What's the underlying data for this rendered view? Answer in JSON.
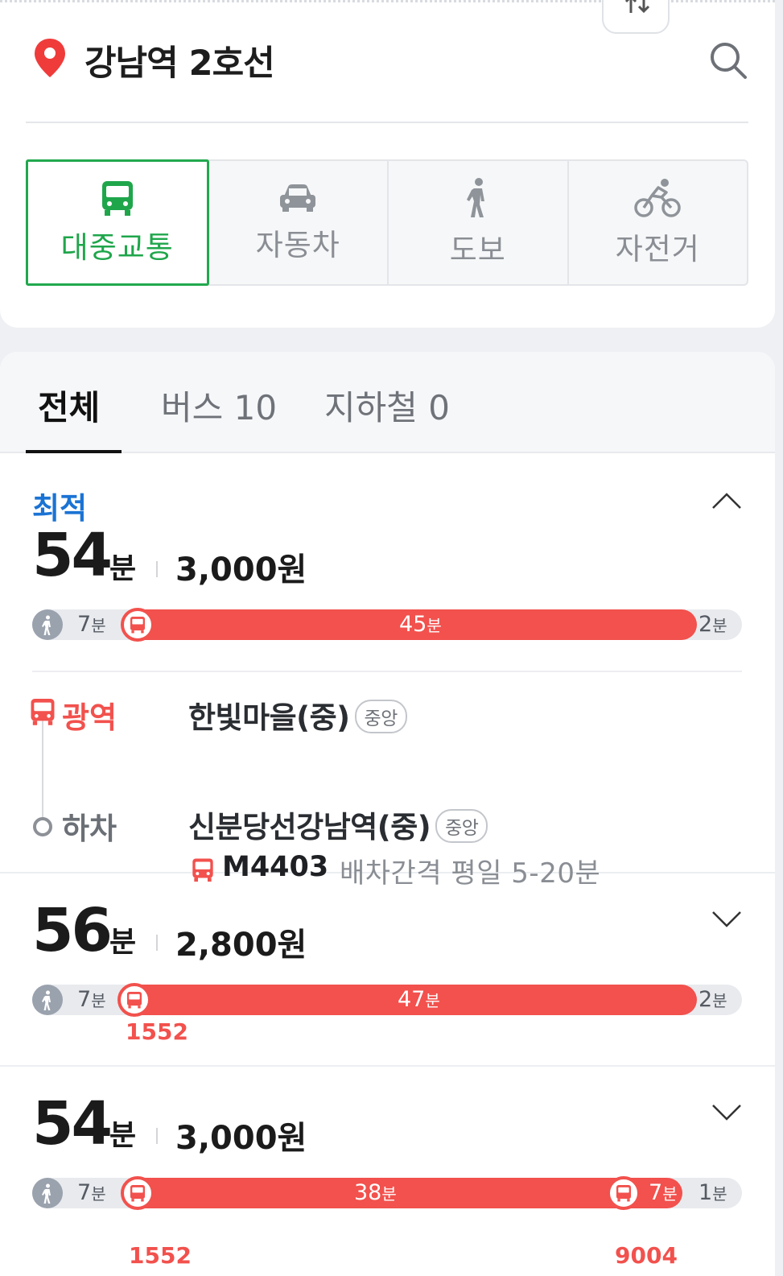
{
  "header": {
    "station_title": "강남역 2호선"
  },
  "modes": [
    {
      "label": "대중교통",
      "icon": "bus-icon",
      "active": true
    },
    {
      "label": "자동차",
      "icon": "car-icon",
      "active": false
    },
    {
      "label": "도보",
      "icon": "walk-icon",
      "active": false
    },
    {
      "label": "자전거",
      "icon": "bicycle-icon",
      "active": false
    }
  ],
  "tabs": [
    {
      "label": "전체",
      "active": true
    },
    {
      "label": "버스 10",
      "active": false
    },
    {
      "label": "지하철 0",
      "active": false
    }
  ],
  "routes": [
    {
      "badge": "최적",
      "duration": "54",
      "duration_unit": "분",
      "fare": "3,000원",
      "segments": [
        {
          "type": "walk",
          "minutes": "7",
          "unit": "분"
        },
        {
          "type": "bus",
          "minutes": "45",
          "unit": "분"
        },
        {
          "type": "walk",
          "minutes": "2",
          "unit": "분"
        }
      ],
      "detail": {
        "type_label": "광역",
        "board_stop": "한빛마을(중)",
        "board_badge": "중앙",
        "line_name": "M4403",
        "headway": "배차간격 평일 5-20분",
        "alight_label": "하차",
        "alight_stop": "신분당선강남역(중)",
        "alight_badge": "중앙"
      }
    },
    {
      "duration": "56",
      "duration_unit": "분",
      "fare": "2,800원",
      "segments": [
        {
          "type": "walk",
          "minutes": "7",
          "unit": "분"
        },
        {
          "type": "bus",
          "minutes": "47",
          "unit": "분",
          "bus_number": "1552"
        },
        {
          "type": "walk",
          "minutes": "2",
          "unit": "분"
        }
      ]
    },
    {
      "duration": "54",
      "duration_unit": "분",
      "fare": "3,000원",
      "segments": [
        {
          "type": "walk",
          "minutes": "7",
          "unit": "분"
        },
        {
          "type": "bus",
          "minutes": "38",
          "unit": "분",
          "bus_number": "1552"
        },
        {
          "type": "bus",
          "minutes": "7",
          "unit": "분",
          "bus_number": "9004"
        },
        {
          "type": "walk",
          "minutes": "1",
          "unit": "분"
        }
      ]
    }
  ],
  "colors": {
    "accent_green": "#21a84e",
    "bus_red": "#f2514d",
    "best_blue": "#1a73d4"
  }
}
